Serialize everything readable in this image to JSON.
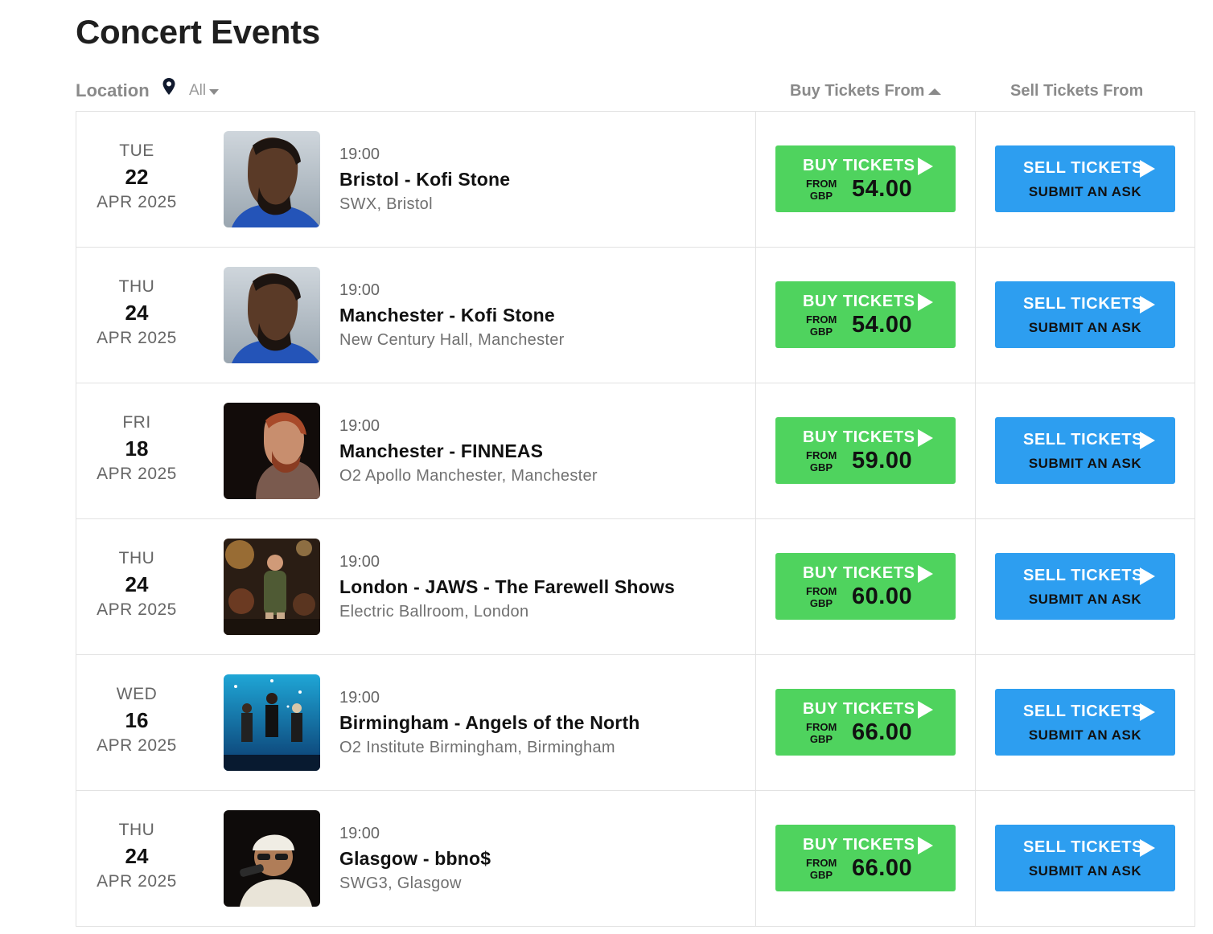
{
  "page": {
    "title": "Concert Events"
  },
  "header": {
    "location_label": "Location",
    "location_filter": "All",
    "col_buy": "Buy Tickets From",
    "col_sell": "Sell Tickets From"
  },
  "colors": {
    "buy_button": "#4fd35e",
    "sell_button": "#2d9ef0"
  },
  "events": [
    {
      "dow": "TUE",
      "day": "22",
      "month_year": "APR 2025",
      "time": "19:00",
      "title": "Bristol - Kofi Stone",
      "venue": "SWX, Bristol",
      "buy_label": "BUY TICKETS",
      "from": "FROM",
      "currency": "GBP",
      "price": "54.00",
      "sell_label": "SELL TICKETS",
      "ask_label": "SUBMIT AN ASK",
      "thumb": "kofi"
    },
    {
      "dow": "THU",
      "day": "24",
      "month_year": "APR 2025",
      "time": "19:00",
      "title": "Manchester - Kofi Stone",
      "venue": "New Century Hall, Manchester",
      "buy_label": "BUY TICKETS",
      "from": "FROM",
      "currency": "GBP",
      "price": "54.00",
      "sell_label": "SELL TICKETS",
      "ask_label": "SUBMIT AN ASK",
      "thumb": "kofi"
    },
    {
      "dow": "FRI",
      "day": "18",
      "month_year": "APR 2025",
      "time": "19:00",
      "title": "Manchester - FINNEAS",
      "venue": "O2 Apollo Manchester, Manchester",
      "buy_label": "BUY TICKETS",
      "from": "FROM",
      "currency": "GBP",
      "price": "59.00",
      "sell_label": "SELL TICKETS",
      "ask_label": "SUBMIT AN ASK",
      "thumb": "finneas"
    },
    {
      "dow": "THU",
      "day": "24",
      "month_year": "APR 2025",
      "time": "19:00",
      "title": "London - JAWS - The Farewell Shows",
      "venue": "Electric Ballroom, London",
      "buy_label": "BUY TICKETS",
      "from": "FROM",
      "currency": "GBP",
      "price": "60.00",
      "sell_label": "SELL TICKETS",
      "ask_label": "SUBMIT AN ASK",
      "thumb": "jaws"
    },
    {
      "dow": "WED",
      "day": "16",
      "month_year": "APR 2025",
      "time": "19:00",
      "title": "Birmingham - Angels of the North",
      "venue": "O2 Institute Birmingham, Birmingham",
      "buy_label": "BUY TICKETS",
      "from": "FROM",
      "currency": "GBP",
      "price": "66.00",
      "sell_label": "SELL TICKETS",
      "ask_label": "SUBMIT AN ASK",
      "thumb": "angels"
    },
    {
      "dow": "THU",
      "day": "24",
      "month_year": "APR 2025",
      "time": "19:00",
      "title": "Glasgow - bbno$",
      "venue": "SWG3, Glasgow",
      "buy_label": "BUY TICKETS",
      "from": "FROM",
      "currency": "GBP",
      "price": "66.00",
      "sell_label": "SELL TICKETS",
      "ask_label": "SUBMIT AN ASK",
      "thumb": "bbno"
    }
  ]
}
